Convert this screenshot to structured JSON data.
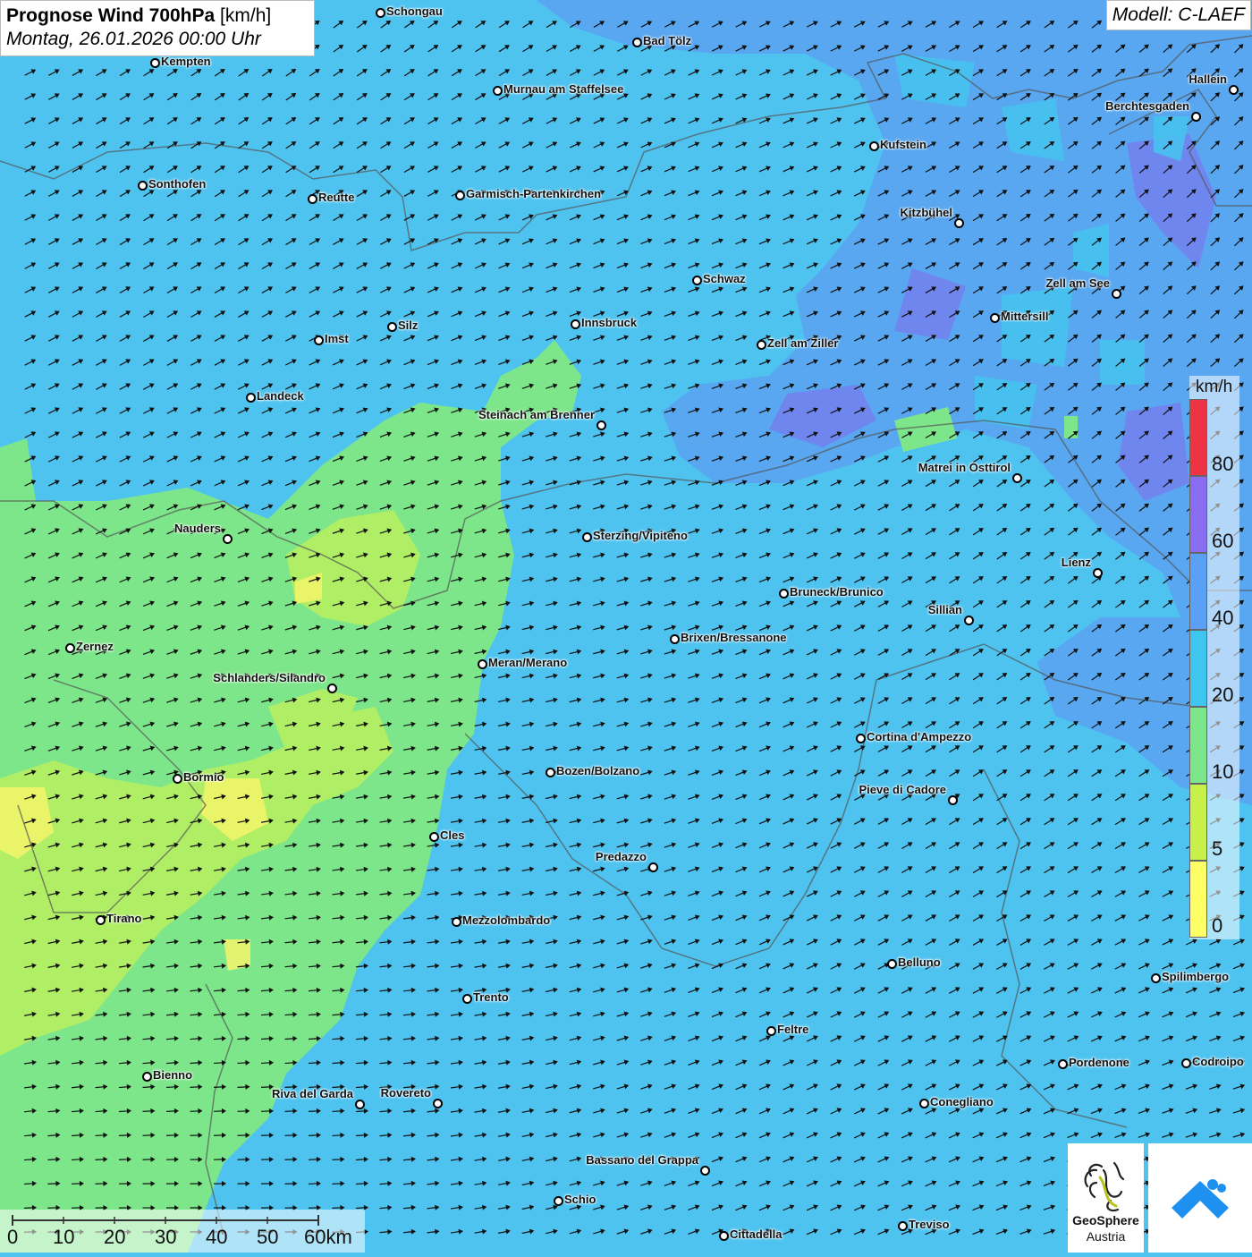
{
  "title": {
    "main": "Prognose Wind 700hPa",
    "unit": "[km/h]",
    "date": "Montag, 26.01.2026 00:00 Uhr"
  },
  "model": "Modell: C-LAEF",
  "legend": {
    "unit": "km/h",
    "ticks": [
      "0",
      "5",
      "10",
      "20",
      "40",
      "60",
      "80"
    ],
    "colors": [
      "#ffff66",
      "#c8f04a",
      "#7ee68a",
      "#3fc6f0",
      "#5aa0f5",
      "#8a6cf0",
      "#ee3344"
    ]
  },
  "scale_bar": {
    "labels": [
      "0",
      "10",
      "20",
      "30",
      "40",
      "50",
      "60km"
    ]
  },
  "cities": [
    {
      "name": "Schongau",
      "label_side": "right"
    },
    {
      "name": "Bad Tölz",
      "label_side": "right"
    },
    {
      "name": "Kempten",
      "label_side": "right"
    },
    {
      "name": "Murnau am Staffelsee",
      "label_side": "right"
    },
    {
      "name": "Hallein",
      "label_side": "left"
    },
    {
      "name": "Berchtesgaden",
      "label_side": "left"
    },
    {
      "name": "Kufstein",
      "label_side": "right"
    },
    {
      "name": "Sonthofen",
      "label_side": "right"
    },
    {
      "name": "Reutte",
      "label_side": "right"
    },
    {
      "name": "Garmisch-Partenkirchen",
      "label_side": "right"
    },
    {
      "name": "Kitzbühel",
      "label_side": "left"
    },
    {
      "name": "Schwaz",
      "label_side": "right"
    },
    {
      "name": "Zell am See",
      "label_side": "left"
    },
    {
      "name": "Mittersill",
      "label_side": "right"
    },
    {
      "name": "Innsbruck",
      "label_side": "right"
    },
    {
      "name": "Silz",
      "label_side": "right"
    },
    {
      "name": "Imst",
      "label_side": "right"
    },
    {
      "name": "Zell am Ziller",
      "label_side": "right"
    },
    {
      "name": "Landeck",
      "label_side": "right"
    },
    {
      "name": "Steinach am Brenner",
      "label_side": "left"
    },
    {
      "name": "Matrei in Osttirol",
      "label_side": "left"
    },
    {
      "name": "Nauders",
      "label_side": "left"
    },
    {
      "name": "Sterzing/Vipiteno",
      "label_side": "right"
    },
    {
      "name": "Lienz",
      "label_side": "left"
    },
    {
      "name": "Bruneck/Brunico",
      "label_side": "right"
    },
    {
      "name": "Sillian",
      "label_side": "left"
    },
    {
      "name": "Zernez",
      "label_side": "right"
    },
    {
      "name": "Brixen/Bressanone",
      "label_side": "right"
    },
    {
      "name": "Meran/Merano",
      "label_side": "right"
    },
    {
      "name": "Schlanders/Silandro",
      "label_side": "left"
    },
    {
      "name": "Cortina d'Ampezzo",
      "label_side": "right"
    },
    {
      "name": "Bozen/Bolzano",
      "label_side": "right"
    },
    {
      "name": "Bormio",
      "label_side": "right"
    },
    {
      "name": "Pieve di Cadore",
      "label_side": "left"
    },
    {
      "name": "Cles",
      "label_side": "right"
    },
    {
      "name": "Predazzo",
      "label_side": "left"
    },
    {
      "name": "Tirano",
      "label_side": "right"
    },
    {
      "name": "Mezzolombardo",
      "label_side": "right"
    },
    {
      "name": "Belluno",
      "label_side": "right"
    },
    {
      "name": "Spilimbergo",
      "label_side": "right"
    },
    {
      "name": "Trento",
      "label_side": "right"
    },
    {
      "name": "Feltre",
      "label_side": "right"
    },
    {
      "name": "Pordenone",
      "label_side": "right"
    },
    {
      "name": "Codroipo",
      "label_side": "right"
    },
    {
      "name": "Bienno",
      "label_side": "right"
    },
    {
      "name": "Riva del Garda",
      "label_side": "left"
    },
    {
      "name": "Rovereto",
      "label_side": "left"
    },
    {
      "name": "Conegliano",
      "label_side": "right"
    },
    {
      "name": "Bassano del Grappa",
      "label_side": "left"
    },
    {
      "name": "Schio",
      "label_side": "right"
    },
    {
      "name": "Treviso",
      "label_side": "right"
    },
    {
      "name": "Cittadella",
      "label_side": "right"
    }
  ],
  "logos": {
    "geosphere_name": "GeoSphere",
    "geosphere_sub": "Austria"
  },
  "wind_direction": "southwest"
}
